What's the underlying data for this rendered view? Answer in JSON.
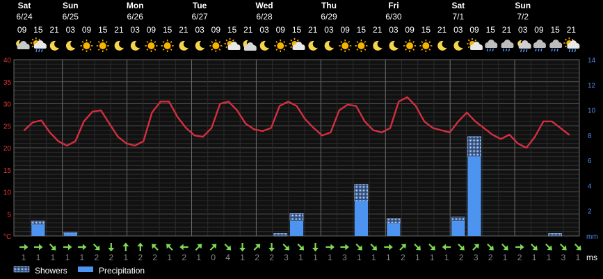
{
  "chart_data": {
    "type": "line",
    "days": [
      {
        "name": "Sat",
        "date": "6/24"
      },
      {
        "name": "Sun",
        "date": "6/25"
      },
      {
        "name": "Mon",
        "date": "6/26"
      },
      {
        "name": "Tue",
        "date": "6/27"
      },
      {
        "name": "Wed",
        "date": "6/28"
      },
      {
        "name": "Thu",
        "date": "6/29"
      },
      {
        "name": "Fri",
        "date": "6/30"
      },
      {
        "name": "Sat",
        "date": "7/1"
      },
      {
        "name": "Sun",
        "date": "7/2"
      }
    ],
    "hours": [
      "09",
      "15",
      "21",
      "03",
      "09",
      "15",
      "21",
      "03",
      "09",
      "15",
      "21",
      "03",
      "09",
      "15",
      "21",
      "03",
      "09",
      "15",
      "21",
      "03",
      "09",
      "15",
      "21",
      "03",
      "09",
      "15",
      "21",
      "03",
      "09",
      "15",
      "21",
      "03",
      "09",
      "15",
      "21"
    ],
    "weather_icons": [
      "cloudy-night",
      "sun-cloud-rain",
      "moon",
      "moon",
      "sun",
      "sun",
      "moon",
      "moon",
      "sun",
      "sun",
      "moon",
      "moon",
      "sun",
      "sun-cloud",
      "moon-cloud",
      "moon",
      "sun",
      "sun-cloud",
      "moon",
      "moon",
      "sun",
      "sun",
      "moon",
      "moon",
      "sun",
      "sun",
      "moon",
      "moon",
      "sun-cloud",
      "rain-cloud",
      "rain-cloud",
      "moon-rain",
      "rain-cloud",
      "rain-cloud",
      "sun-cloud-rain"
    ],
    "temperature_c": [
      24.0,
      25.8,
      26.2,
      23.5,
      21.5,
      20.5,
      21.5,
      26.0,
      28.2,
      28.5,
      25.5,
      22.5,
      21.0,
      20.5,
      21.5,
      28.0,
      30.5,
      30.5,
      27.0,
      24.5,
      22.8,
      22.5,
      24.5,
      30.0,
      30.5,
      28.5,
      25.5,
      24.2,
      23.8,
      24.5,
      29.5,
      30.5,
      29.5,
      26.5,
      24.5,
      22.8,
      23.5,
      28.5,
      29.8,
      29.5,
      26.0,
      24.0,
      23.5,
      24.5,
      30.5,
      31.5,
      29.5,
      26.0,
      24.5,
      24.0,
      23.5,
      26.0,
      28.0,
      26.0,
      24.5,
      23.0,
      22.0,
      23.0,
      21.0,
      20.0,
      22.5,
      26.0,
      26.0,
      24.5,
      23.0
    ],
    "precip_slots": [
      1,
      3,
      16,
      17,
      21,
      23,
      27,
      28,
      29,
      33
    ],
    "precipitation_mm": [
      0.9,
      0.2,
      0,
      1.2,
      2.8,
      1.0,
      1.2,
      6.3,
      0,
      0
    ],
    "showers_mm": [
      0.3,
      0.1,
      0.2,
      0.6,
      1.3,
      0.4,
      0.3,
      1.6,
      0,
      0.2
    ],
    "wind_dir_deg": [
      90,
      90,
      135,
      90,
      90,
      135,
      180,
      0,
      0,
      315,
      315,
      270,
      45,
      45,
      135,
      180,
      45,
      180,
      135,
      135,
      180,
      90,
      90,
      135,
      135,
      90,
      45,
      135,
      135,
      270,
      135,
      45,
      135,
      135,
      90,
      135,
      135,
      135,
      135
    ],
    "wind_speed_ms": [
      1,
      1,
      1,
      1,
      1,
      2,
      2,
      1,
      2,
      2,
      1,
      2,
      1,
      0,
      4,
      1,
      2,
      2,
      3,
      1,
      1,
      1,
      3,
      1,
      1,
      1,
      2,
      1,
      1,
      1,
      2,
      3,
      2,
      1,
      2,
      1,
      1,
      3,
      1
    ],
    "y_left": {
      "unit": "°C",
      "ticks": [
        40,
        35,
        30,
        25,
        20,
        15,
        10,
        5
      ],
      "min": 0,
      "max": 40
    },
    "y_right": {
      "unit": "mm",
      "ticks": [
        14,
        12,
        10,
        8,
        6,
        4,
        2
      ],
      "min": 0,
      "max": 14
    },
    "wind_unit": "ms",
    "legend": [
      {
        "name": "Showers",
        "style": "dotted"
      },
      {
        "name": "Precipitation",
        "style": "solid"
      }
    ],
    "colors": {
      "temperature": "#d32f3f",
      "precipitation": "#4d94f0",
      "showers": "#9ec3f7",
      "wind_arrow": "#7ed957",
      "left_axis": "#e53935",
      "right_axis": "#4f8fe8",
      "grid": "#3a3a3a"
    }
  }
}
